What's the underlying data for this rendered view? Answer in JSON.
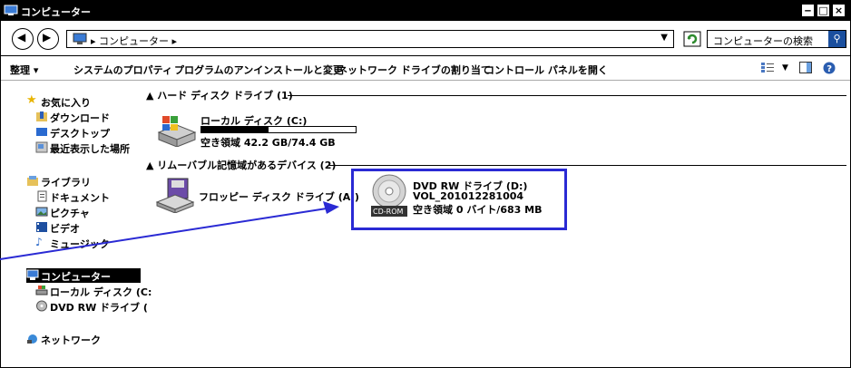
{
  "window": {
    "title": "コンピューター",
    "controls": {
      "minimize": "‒",
      "maximize": "□",
      "close": "×"
    }
  },
  "address": {
    "path": "▸ コンピューター ▸",
    "search_placeholder": "コンピューターの検索"
  },
  "toolbar": {
    "items": [
      "整理 ▾",
      "システムのプロパティ",
      "プログラムのアンインストールと変更",
      "ネットワーク ドライブの割り当て",
      "コントロール パネルを開く"
    ]
  },
  "nav": {
    "favorites": {
      "header": "お気に入り",
      "items": [
        "ダウンロード",
        "デスクトップ",
        "最近表示した場所"
      ]
    },
    "libraries": {
      "header": "ライブラリ",
      "items": [
        "ドキュメント",
        "ピクチャ",
        "ビデオ",
        "ミュージック"
      ]
    },
    "computer": {
      "header": "コンピューター",
      "items": [
        "ローカル ディスク (C:",
        "DVD RW ドライブ ("
      ]
    },
    "network": {
      "header": "ネットワーク"
    }
  },
  "content": {
    "group_hdd": "▲ ハード ディスク ドライブ (1)",
    "group_removable": "▲ リムーバブル記憶域があるデバイス (2)",
    "local_disk": {
      "name": "ローカル ディスク (C:)",
      "free": "空き領域 42.2 GB/74.4 GB",
      "used_fraction": 0.433
    },
    "floppy": {
      "name": "フロッピー ディスク ドライブ (A:)"
    },
    "dvd": {
      "name": "DVD RW ドライブ (D:)",
      "volume": "VOL_201012281004",
      "free": "空き領域 0 バイト/683 MB",
      "icon_badge": "CD-ROM"
    }
  }
}
